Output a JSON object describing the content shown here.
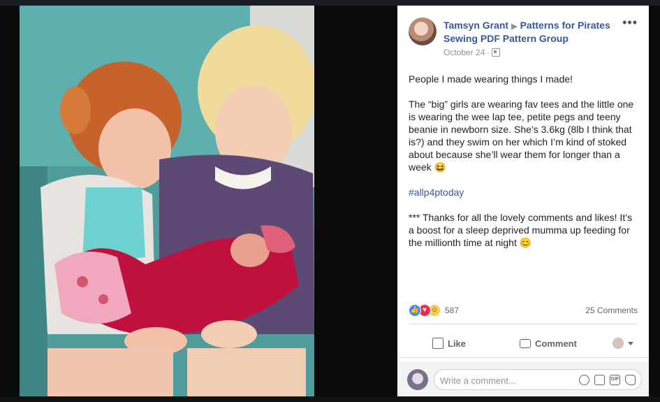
{
  "post": {
    "author": "Tamsyn Grant",
    "group": "Patterns for Pirates",
    "group_line2": "Sewing PDF Pattern Group",
    "date": "October 24",
    "separator": "·",
    "more": "•••",
    "paragraphs": [
      "People I made wearing things I made!",
      "The “big” girls are wearing fav tees and the little one is wearing the wee lap tee, petite pegs and teeny beanie in newborn size. She’s 3.6kg (8lb I think that is?) and they swim on her which I’m kind of stoked about because she’ll wear them for longer than a week 😆",
      "#allp4ptoday",
      "*** Thanks for all the lovely comments and likes! It’s a boost for a sleep deprived mumma up feeding for the millionth time at night 😊"
    ]
  },
  "stats": {
    "reaction_count": "587",
    "comments": "25 Comments"
  },
  "actions": {
    "like": "Like",
    "comment": "Comment"
  },
  "composer": {
    "placeholder": "Write a comment...",
    "gif": "GIF"
  },
  "colors": {
    "link": "#365899",
    "text": "#1d2129",
    "muted": "#90949c",
    "backdrop": "#0b0b0b"
  }
}
